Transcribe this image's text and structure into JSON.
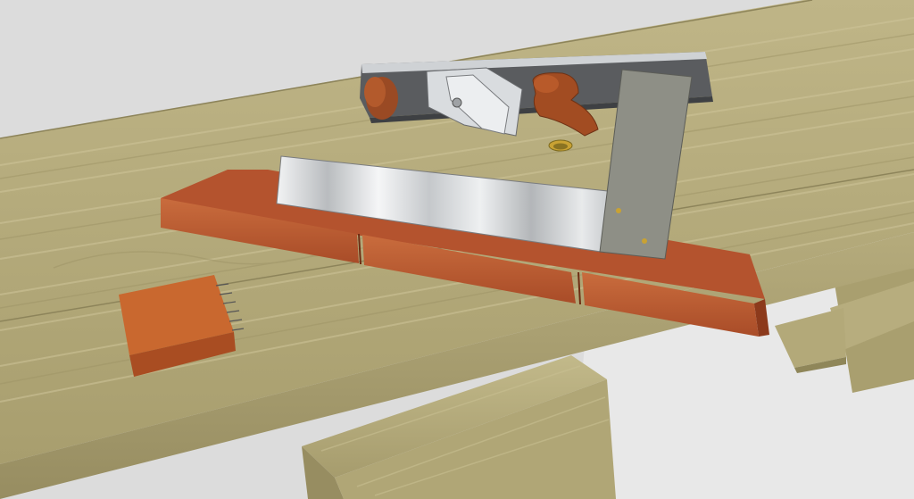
{
  "scene": {
    "subject": "woodworking-workbench-3d-model",
    "objects": [
      "workbench-top",
      "bench-plane",
      "try-square",
      "shooting-board",
      "wood-block",
      "leg-vise-chop",
      "bench-legs"
    ]
  },
  "colors": {
    "background": "#dcdcdc",
    "floor": "#e6e6e6",
    "bench_wood": "#b8ad7c",
    "bench_wood_dark": "#9c9163",
    "board_wood": "#b4532e",
    "board_wood_light": "#c86a3c",
    "plane_body": "#5a5c5f",
    "plane_steel": "#d9dcdf",
    "plane_knob": "#9a4a24",
    "square_blade": "#8e8f86",
    "square_stock": "#d8dadc",
    "dog_hole": "#c9a233"
  }
}
